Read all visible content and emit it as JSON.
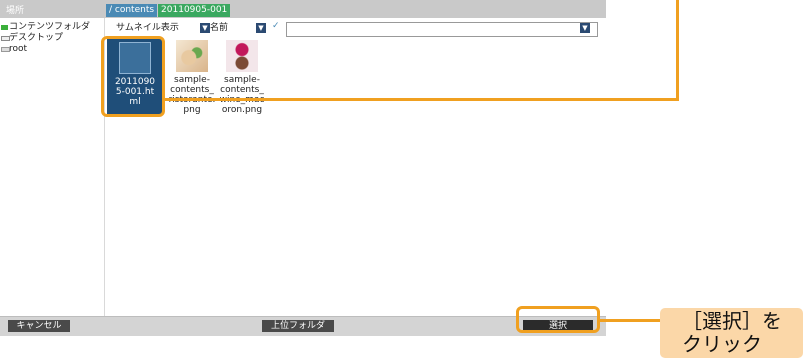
{
  "sidebar": {
    "title": "場所",
    "items": [
      {
        "label": "コンテンツフォルダ",
        "icon": "folder-icon",
        "color": "#3bb03b"
      },
      {
        "label": "デスクトップ",
        "icon": "desktop-icon"
      },
      {
        "label": "root",
        "icon": "drive-icon"
      }
    ]
  },
  "path": {
    "segments": [
      "/ contents",
      "20110905-001"
    ]
  },
  "toolbar": {
    "view_mode": "サムネイル表示",
    "sort_value": "名前",
    "search_value": ""
  },
  "files": [
    {
      "name": "20110905-001.html",
      "display": "2011090\n5-001.ht\nml",
      "selected": true
    },
    {
      "name": "sample-contents_ristorante.png",
      "display": "sample-\ncontents_\nristorante.\npng",
      "selected": false
    },
    {
      "name": "sample-contents_wine_macoron.png",
      "display": "sample-\ncontents_\nwine_mac\noron.png",
      "selected": false
    }
  ],
  "buttons": {
    "cancel": "キャンセル",
    "parent_folder": "上位フォルダ",
    "select": "選択"
  },
  "annotation": {
    "callout_text": "［選択］を\nクリック",
    "highlight_color": "#f0a020"
  }
}
